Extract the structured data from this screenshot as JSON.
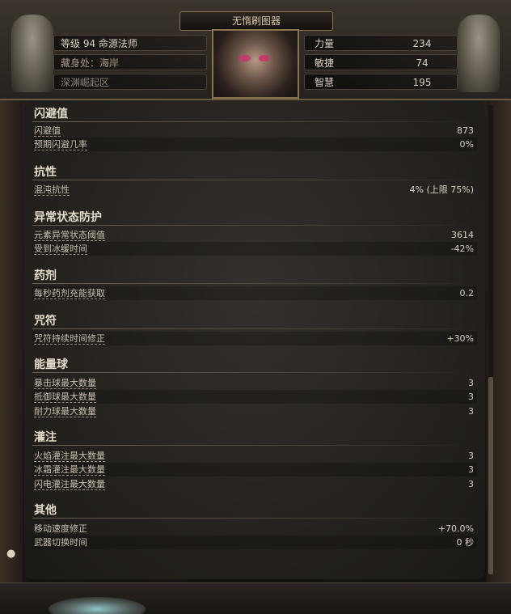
{
  "header": {
    "title": "无惰刷图器",
    "character_level_class": "等级 94 命源法师",
    "location": "藏身处：海岸",
    "league": "深渊崛起区",
    "attributes": [
      {
        "label": "力量",
        "value": "234"
      },
      {
        "label": "敏捷",
        "value": "74"
      },
      {
        "label": "智慧",
        "value": "195"
      }
    ]
  },
  "sections": {
    "evasion": {
      "title": "闪避值",
      "rows": [
        {
          "label": "闪避值",
          "value": "873"
        },
        {
          "label": "预期闪避几率",
          "value": "0%"
        }
      ]
    },
    "resistances": {
      "title": "抗性",
      "rows": [
        {
          "label": "混沌抗性",
          "value": "4% (上限 75%)"
        }
      ]
    },
    "ailment": {
      "title": "异常状态防护",
      "rows": [
        {
          "label": "元素异常状态阈值",
          "value": "3614"
        },
        {
          "label": "受到冰缓时间",
          "value": "-42%"
        }
      ]
    },
    "flasks": {
      "title": "药剂",
      "rows": [
        {
          "label": "每秒药剂充能获取",
          "value": "0.2"
        }
      ]
    },
    "charms": {
      "title": "咒符",
      "rows": [
        {
          "label": "咒符持续时间修正",
          "value": "+30%"
        }
      ]
    },
    "charges": {
      "title": "能量球",
      "rows": [
        {
          "label": "暴击球最大数量",
          "value": "3"
        },
        {
          "label": "抵御球最大数量",
          "value": "3"
        },
        {
          "label": "耐力球最大数量",
          "value": "3"
        }
      ]
    },
    "infusion": {
      "title": "灌注",
      "rows": [
        {
          "label": "火焰灌注最大数量",
          "value": "3"
        },
        {
          "label": "冰霜灌注最大数量",
          "value": "3"
        },
        {
          "label": "闪电灌注最大数量",
          "value": "3"
        }
      ]
    },
    "misc": {
      "title": "其他",
      "rows": [
        {
          "label": "移动速度修正",
          "value": "+70.0%"
        },
        {
          "label": "武器切换时间",
          "value": "0 秒"
        }
      ]
    }
  }
}
